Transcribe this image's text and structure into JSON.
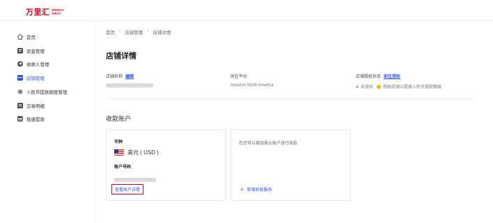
{
  "logo": {
    "cn": "万里汇",
    "en_line1": "WORLD",
    "en_line2": "FIRST"
  },
  "sidebar": {
    "items": [
      {
        "label": "首页",
        "icon": "home-icon"
      },
      {
        "label": "资金管理",
        "icon": "wallet-icon"
      },
      {
        "label": "收款人管理",
        "icon": "user-icon"
      },
      {
        "label": "店铺管理",
        "icon": "store-icon",
        "active": true
      },
      {
        "label": "人民币提款额度管理",
        "icon": "coin-icon"
      },
      {
        "label": "交易明细",
        "icon": "list-icon"
      },
      {
        "label": "极速提款",
        "icon": "database-icon"
      }
    ]
  },
  "breadcrumb": {
    "home": "首页",
    "sep1": "›",
    "store_mgmt": "店铺管理",
    "sep2": "›",
    "store_detail": "店铺详情"
  },
  "page": {
    "title": "店铺详情"
  },
  "store_info": {
    "name_label": "店铺名称",
    "edit_link": "编辑",
    "platform_label": "所在平台",
    "platform_value": "Amazon North America",
    "auth_label": "店铺授权状态",
    "auth_link": "前往授权",
    "auth_status": "未授权",
    "auth_note": "授权店铺以提高人民币提款额度"
  },
  "accounts": {
    "section_title": "收款账户",
    "card1": {
      "currency_label": "币种",
      "currency_value": "美元 ( USD )",
      "account_label": "账户号码",
      "detail_button": "查看账户详情"
    },
    "card2": {
      "hint": "您还可以增加美元账户进行收款",
      "add_button": "新增收款服务",
      "plus": "+"
    }
  },
  "colors": {
    "brand": "#d0021b",
    "link": "#2f54eb",
    "warning": "#faad14"
  }
}
